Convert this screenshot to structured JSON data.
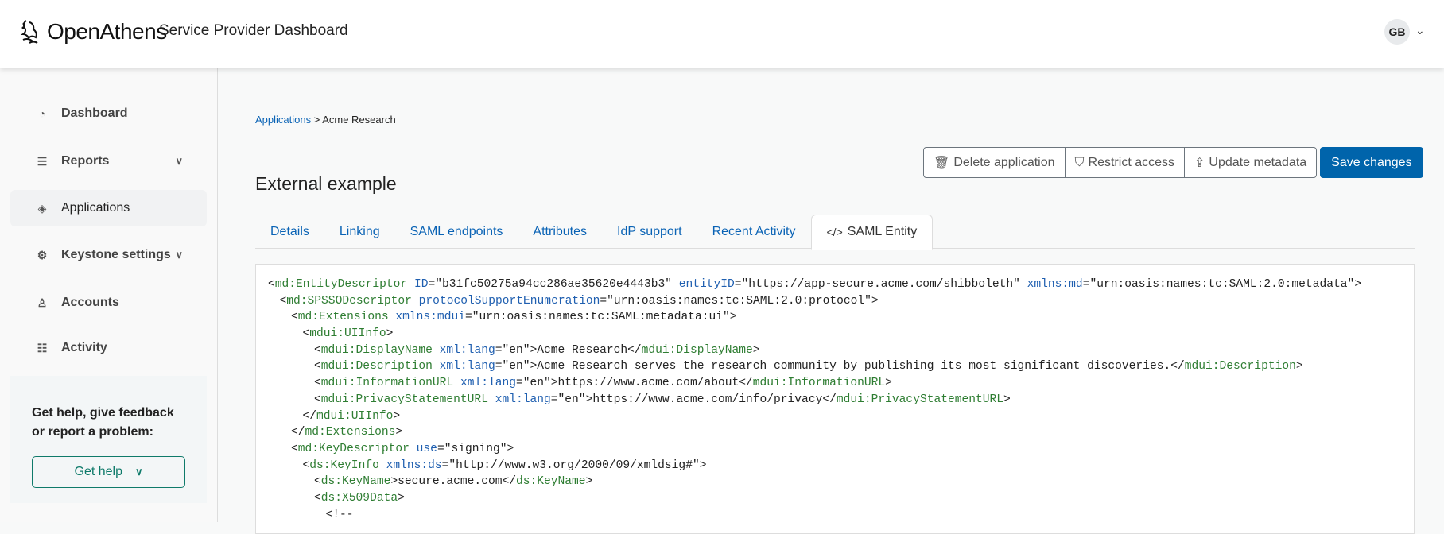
{
  "header": {
    "logo": "OpenAthens",
    "title": "Service Provider Dashboard",
    "avatar": "GB"
  },
  "sidebar": {
    "items": [
      {
        "label": "Dashboard",
        "icon": "gauge-icon",
        "glyph": "◔"
      },
      {
        "label": "Reports",
        "icon": "chart-icon",
        "glyph": "☰",
        "chev": true
      },
      {
        "label": "Applications",
        "icon": "layers-icon",
        "glyph": "◈",
        "active": true
      },
      {
        "label": "Keystone settings",
        "icon": "gear-icon",
        "glyph": "⚙",
        "chev": true
      },
      {
        "label": "Accounts",
        "icon": "users-icon",
        "glyph": "♙"
      },
      {
        "label": "Activity",
        "icon": "inbox-icon",
        "glyph": "☷"
      }
    ],
    "help_text": "Get help, give feedback or report a problem:",
    "help_button": "Get help"
  },
  "breadcrumb": {
    "parent": "Applications",
    "sep": " > ",
    "current": "Acme Research"
  },
  "page_title": "External example",
  "actions": {
    "delete": "Delete application",
    "restrict": "Restrict access",
    "update": "Update metadata",
    "save": "Save changes"
  },
  "tabs": [
    "Details",
    "Linking",
    "SAML endpoints",
    "Attributes",
    "IdP support",
    "Recent Activity",
    "SAML Entity"
  ],
  "active_tab": "SAML Entity",
  "code_lines": [
    {
      "d": 0,
      "s": [
        [
          "p",
          "<"
        ],
        [
          "t",
          "md:EntityDescriptor"
        ],
        [
          "p",
          " "
        ],
        [
          "a",
          "ID"
        ],
        [
          "p",
          "=\"b31fc50275a94cc286ae35620e4443b3\" "
        ],
        [
          "a",
          "entityID"
        ],
        [
          "p",
          "=\"https://app-secure.acme.com/shibboleth\" "
        ],
        [
          "a",
          "xmlns:md"
        ],
        [
          "p",
          "=\"urn:oasis:names:tc:SAML:2.0:metadata\">"
        ]
      ]
    },
    {
      "d": 1,
      "s": [
        [
          "p",
          "<"
        ],
        [
          "t",
          "md:SPSSODescriptor"
        ],
        [
          "p",
          " "
        ],
        [
          "a",
          "protocolSupportEnumeration"
        ],
        [
          "p",
          "=\"urn:oasis:names:tc:SAML:2.0:protocol\">"
        ]
      ]
    },
    {
      "d": 2,
      "s": [
        [
          "p",
          "<"
        ],
        [
          "t",
          "md:Extensions"
        ],
        [
          "p",
          " "
        ],
        [
          "a",
          "xmlns:mdui"
        ],
        [
          "p",
          "=\"urn:oasis:names:tc:SAML:metadata:ui\">"
        ]
      ]
    },
    {
      "d": 3,
      "s": [
        [
          "p",
          "<"
        ],
        [
          "t",
          "mdui:UIInfo"
        ],
        [
          "p",
          ">"
        ]
      ]
    },
    {
      "d": 4,
      "s": [
        [
          "p",
          "<"
        ],
        [
          "t",
          "mdui:DisplayName"
        ],
        [
          "p",
          " "
        ],
        [
          "a",
          "xml:lang"
        ],
        [
          "p",
          "=\"en\">Acme Research</"
        ],
        [
          "t",
          "mdui:DisplayName"
        ],
        [
          "p",
          ">"
        ]
      ]
    },
    {
      "d": 4,
      "s": [
        [
          "p",
          "<"
        ],
        [
          "t",
          "mdui:Description"
        ],
        [
          "p",
          " "
        ],
        [
          "a",
          "xml:lang"
        ],
        [
          "p",
          "=\"en\">Acme Research serves the research community by publishing its most significant discoveries.</"
        ],
        [
          "t",
          "mdui:Description"
        ],
        [
          "p",
          ">"
        ]
      ]
    },
    {
      "d": 4,
      "s": [
        [
          "p",
          "<"
        ],
        [
          "t",
          "mdui:InformationURL"
        ],
        [
          "p",
          " "
        ],
        [
          "a",
          "xml:lang"
        ],
        [
          "p",
          "=\"en\">https://www.acme.com/about</"
        ],
        [
          "t",
          "mdui:InformationURL"
        ],
        [
          "p",
          ">"
        ]
      ]
    },
    {
      "d": 4,
      "s": [
        [
          "p",
          "<"
        ],
        [
          "t",
          "mdui:PrivacyStatementURL"
        ],
        [
          "p",
          " "
        ],
        [
          "a",
          "xml:lang"
        ],
        [
          "p",
          "=\"en\">https://www.acme.com/info/privacy</"
        ],
        [
          "t",
          "mdui:PrivacyStatementURL"
        ],
        [
          "p",
          ">"
        ]
      ]
    },
    {
      "d": 3,
      "s": [
        [
          "p",
          "</"
        ],
        [
          "t",
          "mdui:UIInfo"
        ],
        [
          "p",
          ">"
        ]
      ]
    },
    {
      "d": 2,
      "s": [
        [
          "p",
          "</"
        ],
        [
          "t",
          "md:Extensions"
        ],
        [
          "p",
          ">"
        ]
      ]
    },
    {
      "d": 2,
      "s": [
        [
          "p",
          "<"
        ],
        [
          "t",
          "md:KeyDescriptor"
        ],
        [
          "p",
          " "
        ],
        [
          "a",
          "use"
        ],
        [
          "p",
          "=\"signing\">"
        ]
      ]
    },
    {
      "d": 3,
      "s": [
        [
          "p",
          "<"
        ],
        [
          "t",
          "ds:KeyInfo"
        ],
        [
          "p",
          " "
        ],
        [
          "a",
          "xmlns:ds"
        ],
        [
          "p",
          "=\"http://www.w3.org/2000/09/xmldsig#\">"
        ]
      ]
    },
    {
      "d": 4,
      "s": [
        [
          "p",
          "<"
        ],
        [
          "t",
          "ds:KeyName"
        ],
        [
          "p",
          ">secure.acme.com</"
        ],
        [
          "t",
          "ds:KeyName"
        ],
        [
          "p",
          ">"
        ]
      ]
    },
    {
      "d": 4,
      "s": [
        [
          "p",
          "<"
        ],
        [
          "t",
          "ds:X509Data"
        ],
        [
          "p",
          ">"
        ]
      ]
    },
    {
      "d": 5,
      "s": [
        [
          "p",
          "<!--"
        ]
      ]
    }
  ]
}
